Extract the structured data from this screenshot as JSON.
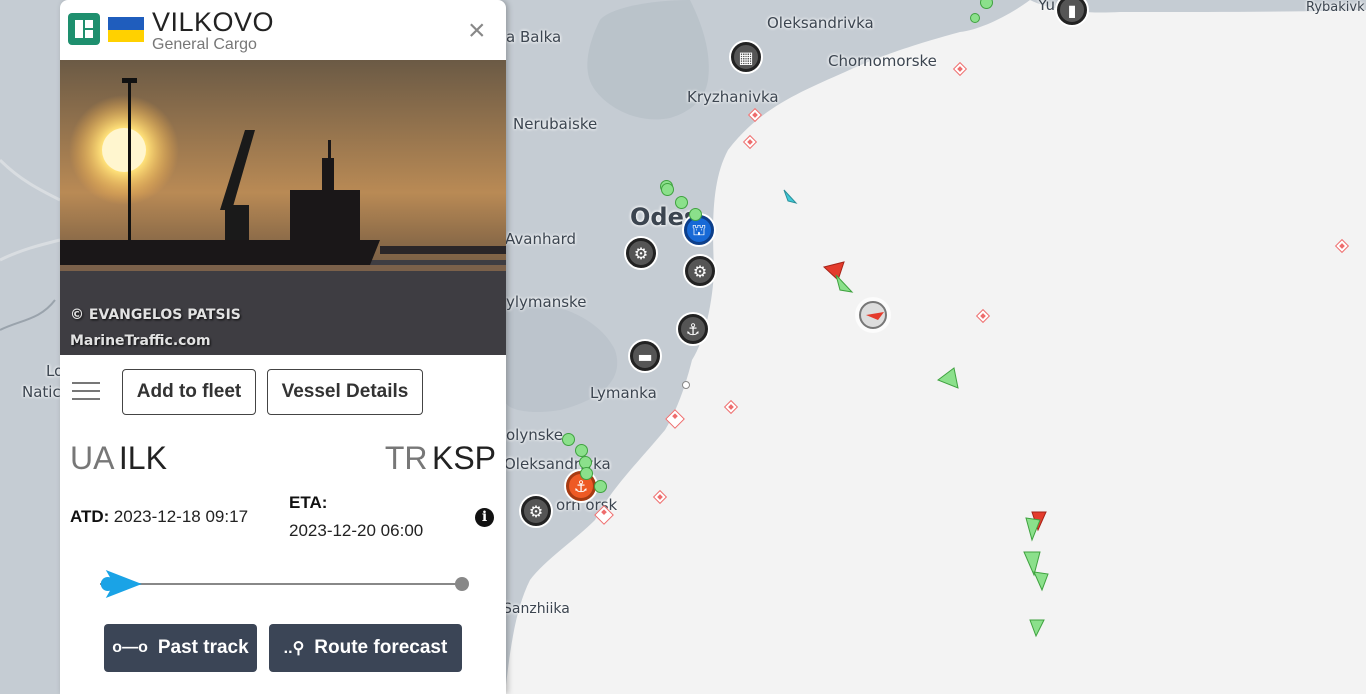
{
  "map": {
    "labels": {
      "oleksandrivka_n": "Oleksandrivka",
      "chornomorske": "Chornomorske",
      "kryzhanivka": "Kryzhanivka",
      "nerubaiske": "Nerubaiske",
      "balka": "a Balka",
      "odesa": "Odes",
      "avanhard": "Avanhard",
      "chornomorske_s": "ylymanske",
      "lymanka": "Lymanka",
      "olynske": "olynske",
      "oleksandrivka_s": "Oleksandrivka",
      "chornomorsk": "orn   orsk",
      "sanzhiika": "Sanzhiika",
      "rybakivka": "Rybakivk",
      "yuzhne": "Yu",
      "left1": "Lo",
      "left2": "Natic"
    },
    "colors": {
      "land": "#c5ccd3",
      "sea": "#f3f3f3"
    }
  },
  "panel": {
    "vessel_name": "VILKOVO",
    "vessel_type": "General Cargo",
    "flag": "Ukraine",
    "close_label": "×",
    "photo_credit_1": "© EVANGELOS PATSIS",
    "photo_credit_2": "MarineTraffic.com",
    "menu_icon": "hamburger-icon",
    "add_to_fleet": "Add to fleet",
    "vessel_details": "Vessel Details",
    "origin_cc": "UA",
    "origin_port": "ILK",
    "dest_cc": "TR",
    "dest_port": "KSP",
    "atd_label": "ATD:",
    "atd_value": "2023-12-18 09:17",
    "eta_label": "ETA:",
    "eta_value": "2023-12-20 06:00",
    "info_icon": "info-icon",
    "progress_fraction": 0.08,
    "past_track": "Past track",
    "route_forecast": "Route forecast"
  }
}
